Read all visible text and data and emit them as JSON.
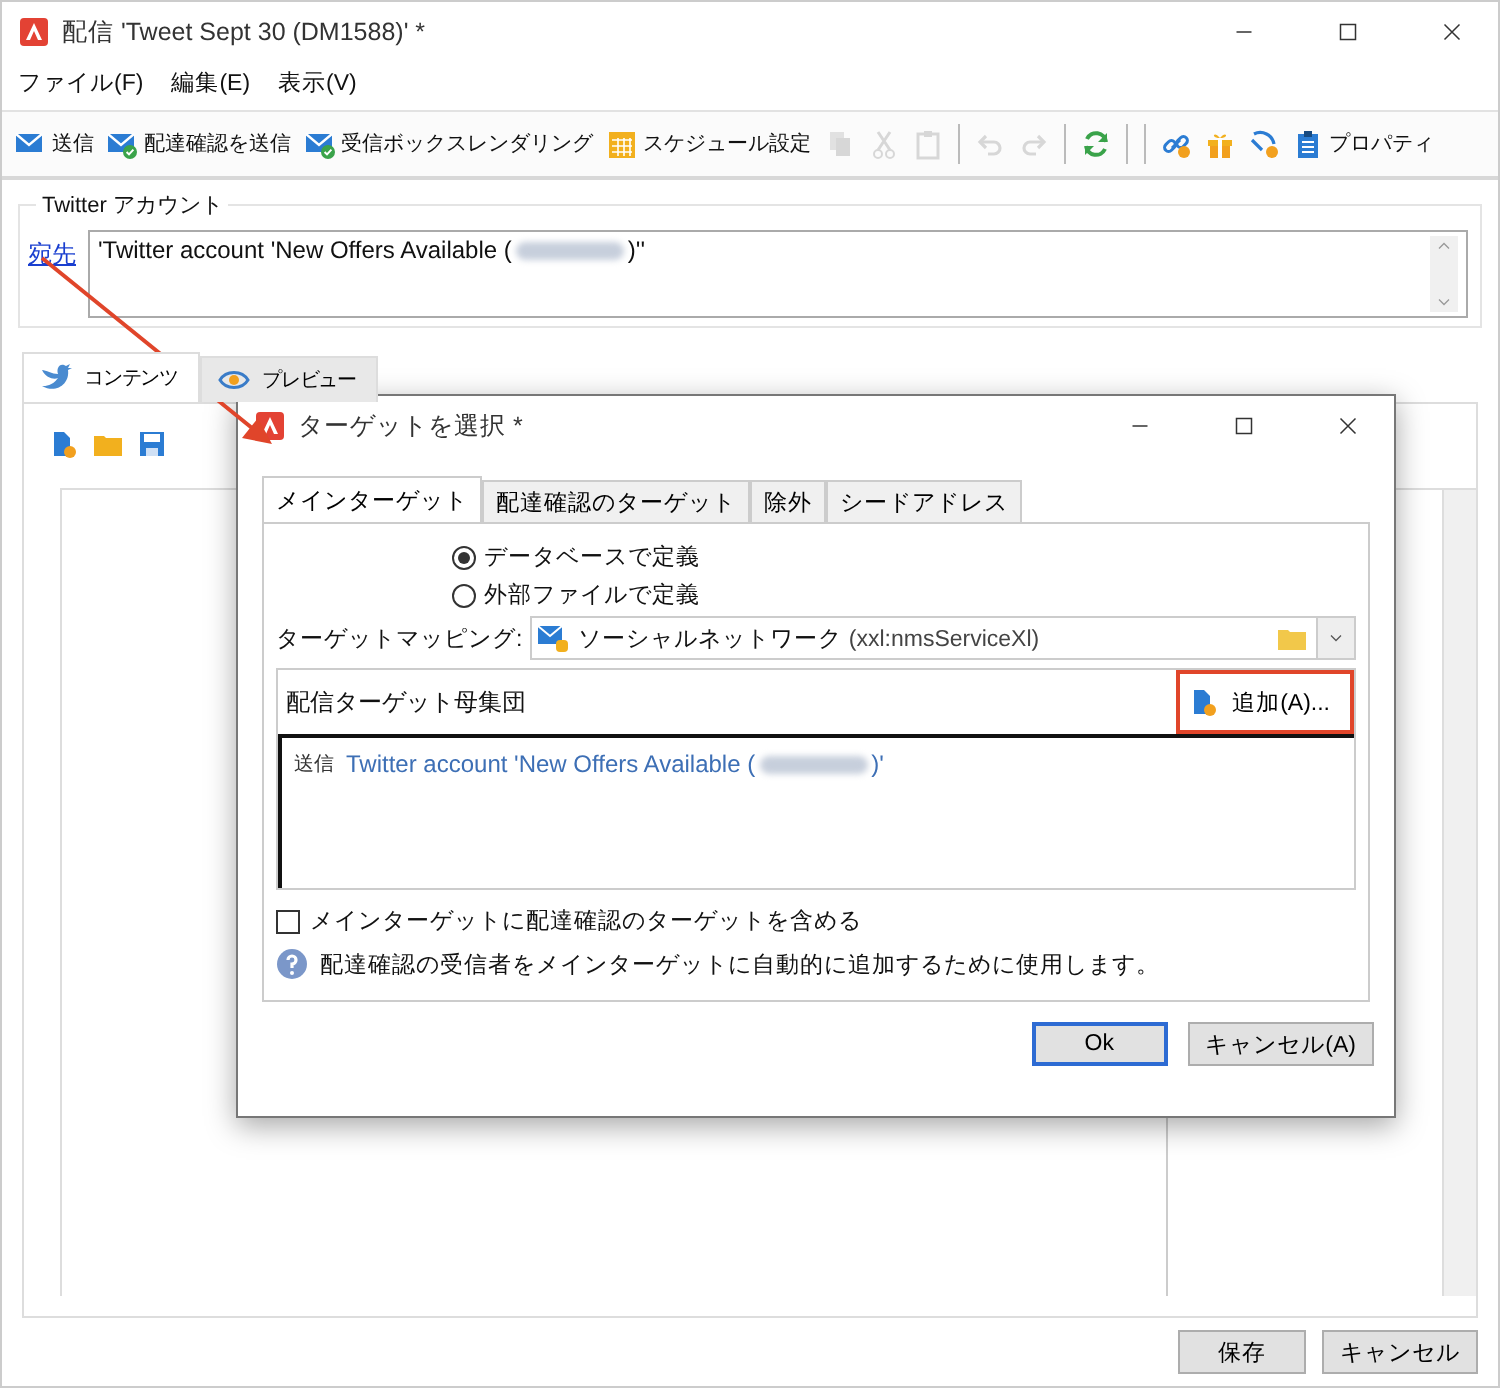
{
  "window": {
    "title": "配信 'Tweet Sept 30 (DM1588)' *"
  },
  "menu": [
    "ファイル(F)",
    "編集(E)",
    "表示(V)"
  ],
  "toolbar": [
    {
      "kind": "button",
      "label": "送信",
      "disabled": false
    },
    {
      "kind": "button",
      "label": "配達確認を送信",
      "disabled": false
    },
    {
      "kind": "button",
      "label": "受信ボックスレンダリング",
      "disabled": false
    },
    {
      "kind": "button",
      "label": "スケジュール設定",
      "disabled": false
    },
    {
      "kind": "button",
      "disabled": true
    },
    {
      "kind": "button",
      "disabled": true
    },
    {
      "kind": "button",
      "disabled": true
    },
    {
      "kind": "separator"
    },
    {
      "kind": "button",
      "disabled": true
    },
    {
      "kind": "button",
      "disabled": true
    },
    {
      "kind": "separator"
    },
    {
      "kind": "button",
      "disabled": false
    },
    {
      "kind": "separator"
    },
    {
      "kind": "separator"
    },
    {
      "kind": "button",
      "disabled": false
    },
    {
      "kind": "button",
      "disabled": false
    },
    {
      "kind": "button",
      "disabled": false
    },
    {
      "kind": "button",
      "label": "プロパティ",
      "disabled": false
    }
  ],
  "account": {
    "legend": "Twitter アカウント",
    "link": "宛先",
    "value_start": "'Twitter account 'New Offers Available (",
    "value_end": ")''"
  },
  "tabs": [
    {
      "label": "コンテンツ",
      "selected": true
    },
    {
      "label": "プレビュー",
      "selected": false
    }
  ],
  "dialog": {
    "title": "ターゲットを選択 *",
    "tabs": [
      {
        "label": "メインターゲット",
        "selected": true
      },
      {
        "label": "配達確認のターゲット",
        "selected": false
      },
      {
        "label": "除外",
        "selected": false
      },
      {
        "label": "シードアドレス",
        "selected": false
      }
    ],
    "radios": [
      {
        "label": "データベースで定義",
        "selected": true
      },
      {
        "label": "外部ファイルで定義",
        "selected": false
      }
    ],
    "mapping": {
      "label": "ターゲットマッピング:",
      "value": "ソーシャルネットワーク",
      "suffix": "(xxl:nmsServiceXl)"
    },
    "population": {
      "title": "配信ターゲット母集団",
      "add_button": "追加(A)...",
      "add_highlighted": true,
      "rows": [
        {
          "type": "送信",
          "start": "Twitter account 'New Offers Available (",
          "end": ")'"
        }
      ]
    },
    "checkbox": {
      "label": "メインターゲットに配達確認のターゲットを含める",
      "checked": false
    },
    "help": "配達確認の受信者をメインターゲットに自動的に追加するために使用します。",
    "buttons": [
      {
        "label": "Ok",
        "focused": true
      },
      {
        "label": "キャンセル(A)",
        "focused": false
      }
    ]
  },
  "footer": {
    "buttons": [
      "保存",
      "キャンセル"
    ]
  }
}
